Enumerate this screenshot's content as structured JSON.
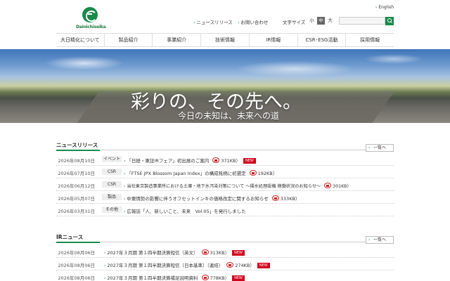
{
  "header": {
    "logo_text": "Dainichiseika",
    "english": "English",
    "news_link": "ニュースリリース",
    "contact_link": "お問い合わせ",
    "font_size_label": "文字サイズ",
    "font_sizes": [
      "小",
      "中",
      "大"
    ],
    "active_font_size": "中"
  },
  "nav": [
    "大日精化について",
    "製品紹介",
    "事業紹介",
    "技術情報",
    "IR情報",
    "CSR･ESG活動",
    "採用情報"
  ],
  "hero": {
    "title": "彩りの、その先へ。",
    "subtitle": "今日の未知は、未来への道"
  },
  "news": {
    "heading": "ニュースリリース",
    "more": "一覧へ",
    "items": [
      {
        "date": "2026年08月10日",
        "category": "イベント",
        "title": "「日経・東証IRフェア」初出展のご案内",
        "size": "371KB",
        "new": "NEW"
      },
      {
        "date": "2026年07月10日",
        "category": "CSR",
        "title": "「FTSE JPX Blossom Japan Index」の構成銘柄に初選定",
        "size": "192KB",
        "new": ""
      },
      {
        "date": "2026年06月12日",
        "category": "CSR",
        "title": "当社東京製造事業所における土壌・地下水汚染対策について ～揚水処理設備 稼働状況のお知らせ～",
        "size": "301KB",
        "new": ""
      },
      {
        "date": "2026年05月07日",
        "category": "製品",
        "title": "中東情勢の影響に伴うオフセットインキの価格改定に関するお知らせ",
        "size": "333KB",
        "new": ""
      },
      {
        "date": "2026年03月31日",
        "category": "その他",
        "title": "広報誌「人、新しいこと、未来　Vol.05」を発行しました",
        "size": "",
        "new": ""
      }
    ]
  },
  "ir": {
    "heading": "IRニュース",
    "more": "一覧へ",
    "items": [
      {
        "date": "2026年08月06日",
        "title": "2027年３月期 第１四半期決算短信（英文）",
        "size": "313KB",
        "new": "NEW"
      },
      {
        "date": "2026年08月06日",
        "title": "2027年３月期 第１四半期決算短信〔日本基準〕（連結）",
        "size": "274KB",
        "new": "NEW"
      },
      {
        "date": "2026年08月06日",
        "title": "2027年３月期 第１四半期決算補足説明資料",
        "size": "778KB",
        "new": "NEW"
      }
    ]
  },
  "colors": {
    "brand_green": "#1a8a4a",
    "new_badge": "#d0021b"
  }
}
